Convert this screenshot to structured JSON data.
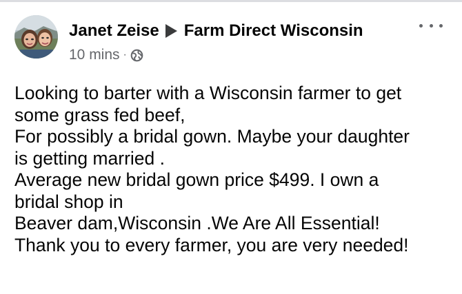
{
  "post": {
    "author": "Janet Zeise",
    "group": "Farm Direct Wisconsin",
    "timestamp": "10 mins",
    "separator": "·",
    "privacy_icon": "globe-icon",
    "more_icon": "more-options-icon",
    "lines": [
      "Looking to barter with a Wisconsin farmer to get",
      "some grass fed beef,",
      "For possibly a bridal gown. Maybe your daughter",
      "is getting married .",
      "Average new bridal gown price $499. I own a",
      "bridal shop in",
      "Beaver dam,Wisconsin .We Are All Essential!",
      "Thank you to every farmer, you are very needed!"
    ]
  },
  "colors": {
    "text": "#050505",
    "secondary_text": "#65676b",
    "divider": "#dcdde1"
  }
}
